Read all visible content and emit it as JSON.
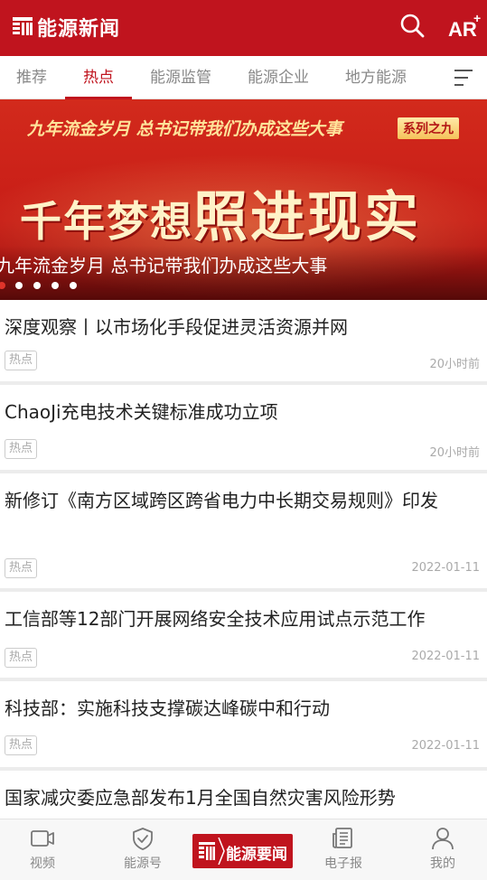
{
  "header": {
    "app_title": "能源新闻",
    "ar_label": "AR",
    "ar_plus": "+"
  },
  "tabs": [
    {
      "label": "推荐",
      "active": false
    },
    {
      "label": "热点",
      "active": true
    },
    {
      "label": "能源监管",
      "active": false
    },
    {
      "label": "能源企业",
      "active": false
    },
    {
      "label": "地方能源",
      "active": false
    }
  ],
  "banner": {
    "top_line": "九年流金岁月 总书记带我们办成这些大事",
    "series_badge": "系列之九",
    "headline_part1": "千年梦想",
    "headline_part2": "照进现实",
    "caption": "九年流金岁月 总书记带我们办成这些大事",
    "slide_count": 5,
    "active_slide": 1
  },
  "news": [
    {
      "title": "深度观察丨以市场化手段促进灵活资源并网",
      "tag": "热点",
      "time": "20小时前"
    },
    {
      "title": "ChaoJi充电技术关键标准成功立项",
      "tag": "热点",
      "time": "20小时前"
    },
    {
      "title": "新修订《南方区域跨区跨省电力中长期交易规则》印发",
      "tag": "热点",
      "time": "2022-01-11"
    },
    {
      "title": "工信部等12部门开展网络安全技术应用试点示范工作",
      "tag": "热点",
      "time": "2022-01-11"
    },
    {
      "title": "科技部：实施科技支撑碳达峰碳中和行动",
      "tag": "热点",
      "time": "2022-01-11"
    },
    {
      "title": "国家减灾委应急部发布1月全国自然灾害风险形势",
      "tag": "",
      "time": ""
    }
  ],
  "bottom_nav": {
    "video": "视频",
    "energy_account": "能源号",
    "center": "能源要闻",
    "epaper": "电子报",
    "mine": "我的"
  },
  "colors": {
    "brand_red": "#c0141e",
    "text_dark": "#222222",
    "text_muted": "#aaaaaa"
  }
}
